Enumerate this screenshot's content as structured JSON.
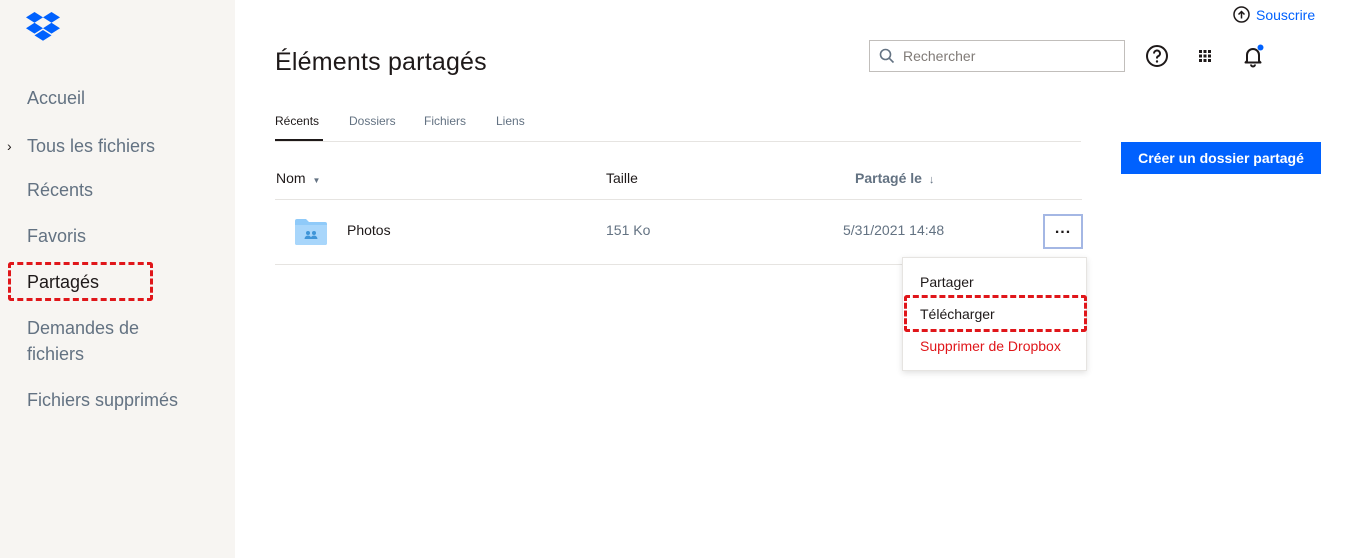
{
  "header": {
    "upgrade_label": "Souscrire",
    "page_title": "Éléments partagés",
    "search_placeholder": "Rechercher"
  },
  "sidebar": {
    "items": [
      {
        "label": "Accueil"
      },
      {
        "label": "Tous les fichiers"
      },
      {
        "label": "Récents"
      },
      {
        "label": "Favoris"
      },
      {
        "label": "Partagés"
      },
      {
        "label": "Demandes de fichiers"
      },
      {
        "label": "Fichiers supprimés"
      }
    ]
  },
  "tabs": [
    {
      "label": "Récents"
    },
    {
      "label": "Dossiers"
    },
    {
      "label": "Fichiers"
    },
    {
      "label": "Liens"
    }
  ],
  "create_button_label": "Créer un dossier partagé",
  "table": {
    "columns": {
      "name": "Nom",
      "size": "Taille",
      "shared": "Partagé le"
    },
    "rows": [
      {
        "name": "Photos",
        "size": "151 Ko",
        "shared": "5/31/2021 14:48"
      }
    ]
  },
  "context_menu": {
    "items": [
      {
        "label": "Partager"
      },
      {
        "label": "Télécharger"
      },
      {
        "label": "Supprimer de Dropbox"
      }
    ]
  },
  "colors": {
    "accent": "#0061fe",
    "danger": "#e0161a",
    "sidebar_bg": "#f7f5f2",
    "folder": "#8fcaf9"
  }
}
